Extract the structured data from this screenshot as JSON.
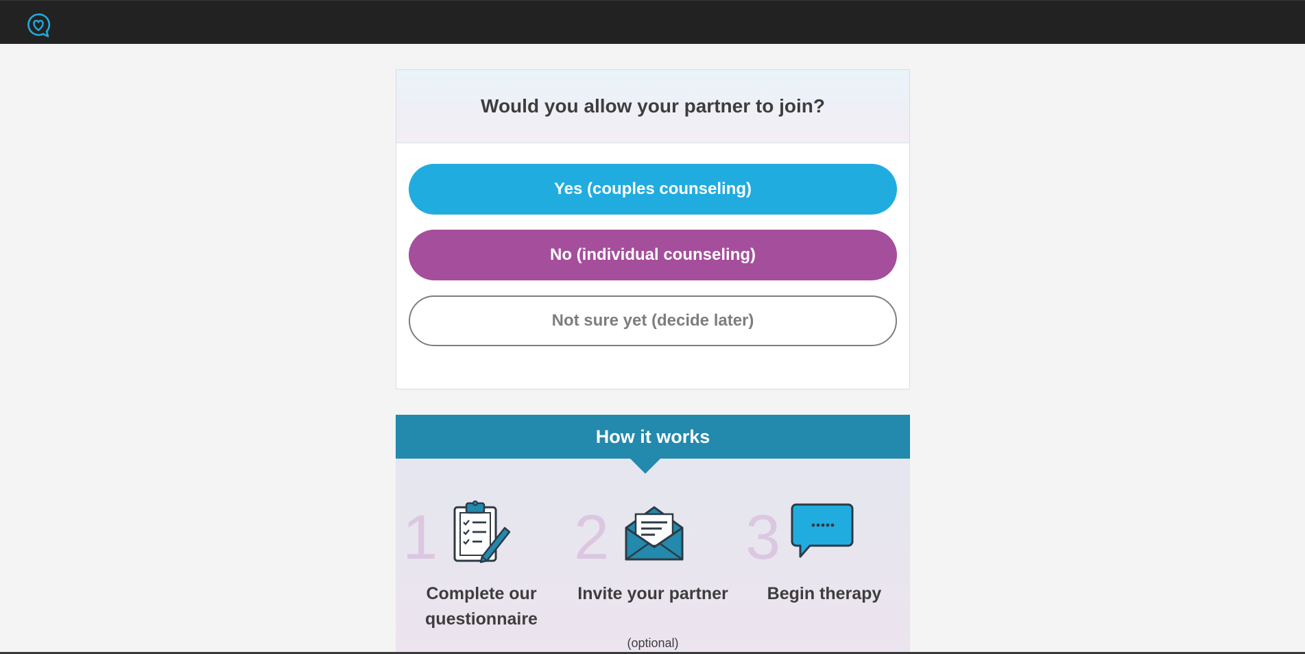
{
  "header": {
    "logo_icon": "heart-chat-bubble-icon",
    "accent": "#21ace0"
  },
  "question": {
    "title": "Would you allow your partner to join?",
    "options": [
      {
        "label": "Yes (couples counseling)",
        "color": "#21ace0"
      },
      {
        "label": "No (individual counseling)",
        "color": "#a54e9c"
      },
      {
        "label": "Not sure yet (decide later)",
        "color": "#7d7d7d"
      }
    ]
  },
  "how_it_works": {
    "title": "How it works",
    "color": "#2389ad",
    "steps": [
      {
        "number": "1",
        "label": "Complete our questionnaire",
        "icon": "clipboard-checklist-icon"
      },
      {
        "number": "2",
        "label": "Invite your partner",
        "sublabel": "(optional)",
        "icon": "envelope-letter-icon"
      },
      {
        "number": "3",
        "label": "Begin therapy",
        "icon": "speech-bubble-icon"
      }
    ]
  }
}
